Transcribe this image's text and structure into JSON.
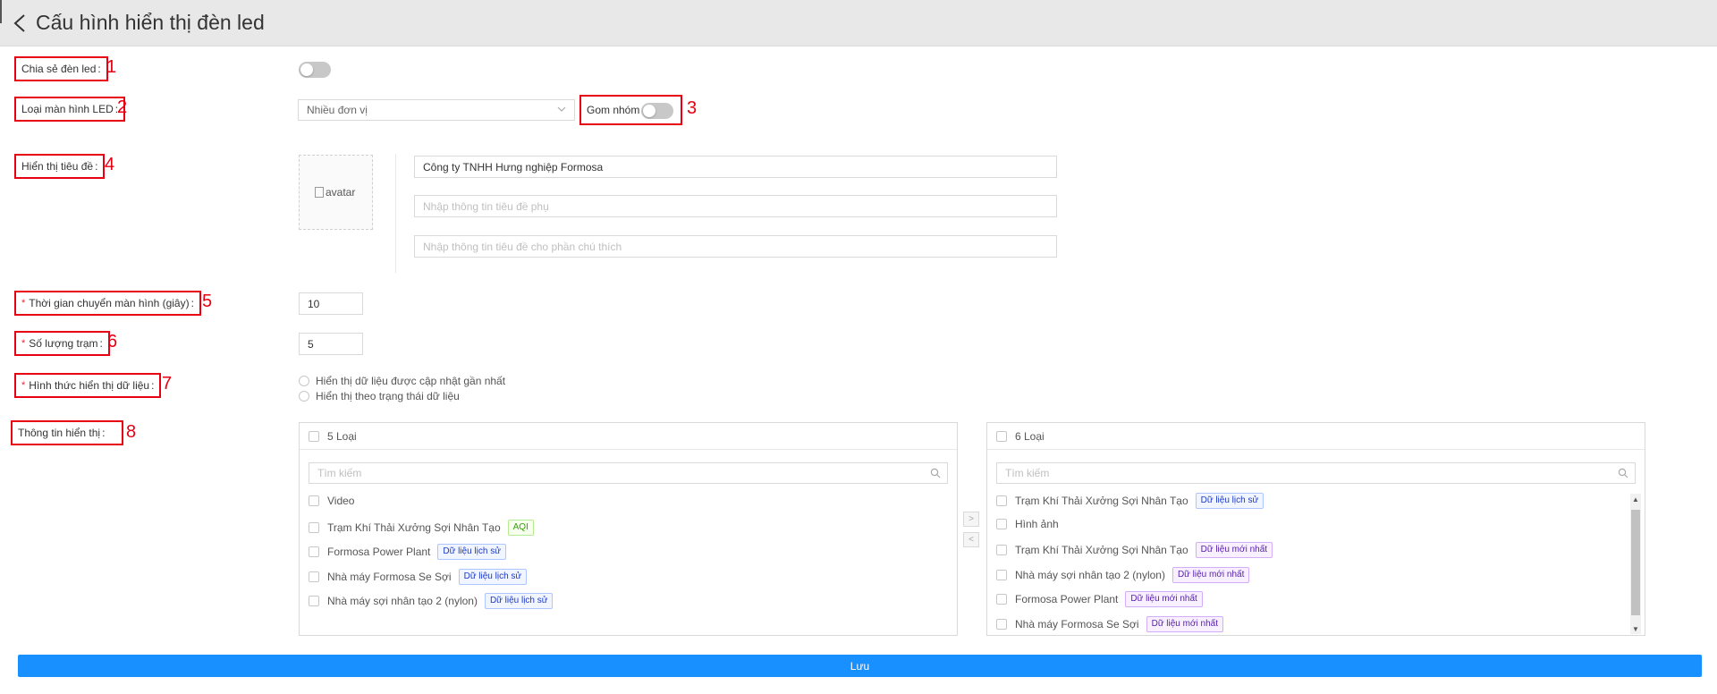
{
  "header": {
    "title": "Cấu hình hiển thị đèn led"
  },
  "labels": {
    "share": "Chia sẻ đèn led",
    "screen_type": "Loại màn hình LED",
    "group": "Gom nhóm",
    "show_title": "Hiển thị tiêu đề",
    "switch_time": "Thời gian chuyển màn hình (giây)",
    "station_count": "Số lượng trạm",
    "display_mode": "Hình thức hiển thị dữ liệu",
    "display_info": "Thông tin hiển thị",
    "colon": ":",
    "required_mark": "*"
  },
  "annotations": [
    "1",
    "2",
    "3",
    "4",
    "5",
    "6",
    "7",
    "8"
  ],
  "screen_type": {
    "selected": "Nhiều đơn vị"
  },
  "toggles": {
    "share_on": false,
    "group_on": false
  },
  "title_section": {
    "avatar_alt": "avatar",
    "title_value": "Công ty TNHH Hưng nghiệp Formosa",
    "subtitle_placeholder": "Nhập thông tin tiêu đề phụ",
    "note_placeholder": "Nhập thông tin tiêu đề cho phần chú thích"
  },
  "switch_time_value": "10",
  "station_count_value": "5",
  "display_mode_options": [
    "Hiển thị dữ liệu được cập nhật gần nhất",
    "Hiển thị theo trạng thái dữ liệu"
  ],
  "transfer": {
    "left": {
      "header": "5 Loại",
      "search_placeholder": "Tìm kiếm",
      "items": [
        {
          "label": "Video",
          "tag": "",
          "tag_color": ""
        },
        {
          "label": "Trạm Khí Thải Xưởng Sợi Nhân Tạo",
          "tag": "AQI",
          "tag_color": "green"
        },
        {
          "label": "Formosa Power Plant",
          "tag": "Dữ liệu lịch sử",
          "tag_color": "blue"
        },
        {
          "label": "Nhà máy Formosa Se Sợi",
          "tag": "Dữ liệu lịch sử",
          "tag_color": "blue"
        },
        {
          "label": "Nhà máy sợi nhân tạo 2 (nylon)",
          "tag": "Dữ liệu lịch sử",
          "tag_color": "blue"
        }
      ]
    },
    "right": {
      "header": "6 Loại",
      "search_placeholder": "Tìm kiếm",
      "items": [
        {
          "label": "Trạm Khí Thải Xưởng Sợi Nhân Tạo",
          "tag": "Dữ liệu lịch sử",
          "tag_color": "blue"
        },
        {
          "label": "Hình ảnh",
          "tag": "",
          "tag_color": ""
        },
        {
          "label": "Trạm Khí Thải Xưởng Sợi Nhân Tạo",
          "tag": "Dữ liệu mới nhất",
          "tag_color": "purple"
        },
        {
          "label": "Nhà máy sợi nhân tạo 2 (nylon)",
          "tag": "Dữ liệu mới nhất",
          "tag_color": "purple"
        },
        {
          "label": "Formosa Power Plant",
          "tag": "Dữ liệu mới nhất",
          "tag_color": "purple"
        },
        {
          "label": "Nhà máy Formosa Se Sợi",
          "tag": "Dữ liệu mới nhất",
          "tag_color": "purple"
        }
      ]
    },
    "move_right_glyph": ">",
    "move_left_glyph": "<"
  },
  "save_label": "Lưu",
  "colors": {
    "primary": "#1890ff",
    "annotation_red": "#e60012",
    "header_bg": "#e8e8e8"
  }
}
